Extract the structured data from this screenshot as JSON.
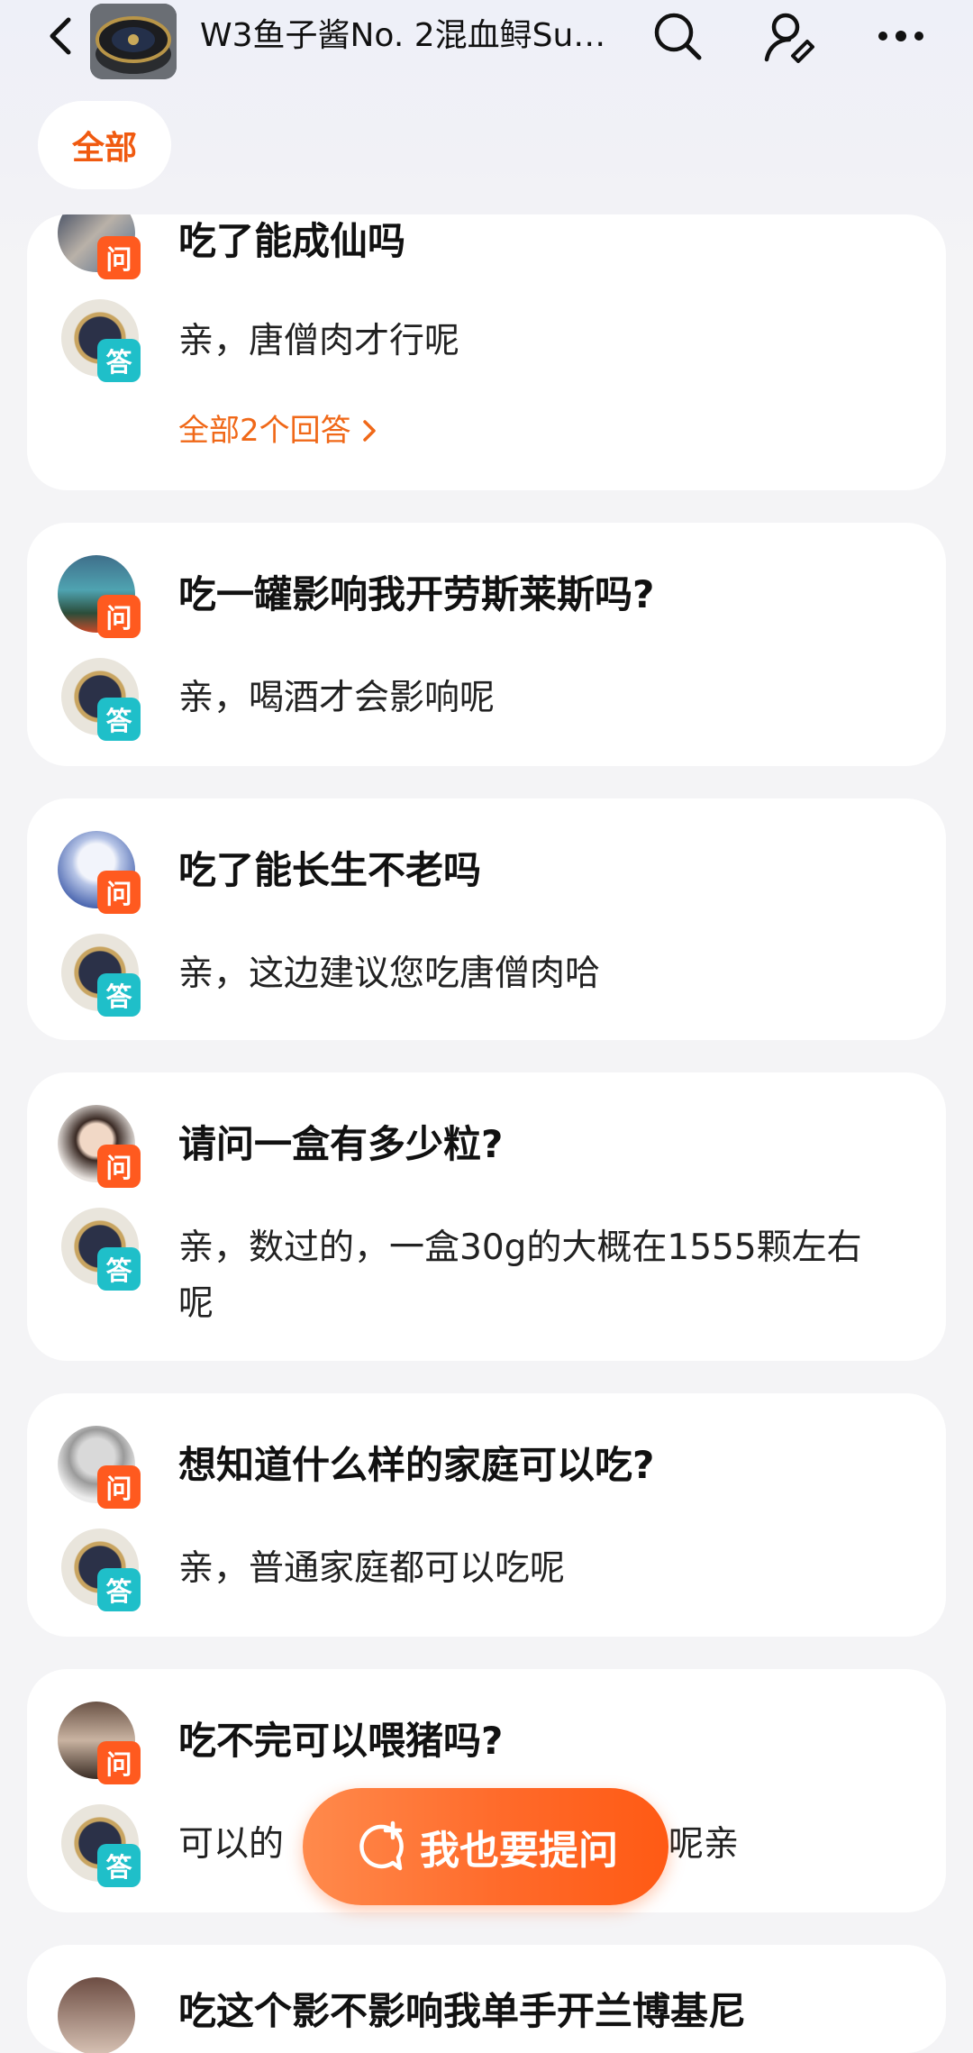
{
  "header": {
    "title": "W3鱼子酱No. 2混血鲟Sup..."
  },
  "tab": {
    "label": "全部"
  },
  "cards": [
    {
      "question": "吃了能成仙吗",
      "answer": "亲，唐僧肉才行呢",
      "more": "全部2个回答"
    },
    {
      "question": "吃一罐影响我开劳斯莱斯吗?",
      "answer": "亲，喝酒才会影响呢"
    },
    {
      "question": "吃了能长生不老吗",
      "answer": "亲，这边建议您吃唐僧肉哈"
    },
    {
      "question": "请问一盒有多少粒?",
      "answer_line1": "亲，数过的，一盒30g的大概在1555颗左右",
      "answer_line2": "呢"
    },
    {
      "question": "想知道什么样的家庭可以吃?",
      "answer": "亲，普通家庭都可以吃呢"
    },
    {
      "question": "吃不完可以喂猪吗?",
      "answer_left": "可以的",
      "answer_right": "呢亲"
    },
    {
      "question": "吃这个影不影响我单手开兰博基尼"
    }
  ],
  "badges": {
    "q": "问",
    "a": "答"
  },
  "ask_button": {
    "label": "我也要提问"
  },
  "colors": {
    "accent": "#f05a10",
    "q_badge": "#ff5a1f",
    "a_badge": "#1fbfc9"
  },
  "icons": {
    "back": "chevron-left-icon",
    "search": "search-icon",
    "ask": "person-question-icon",
    "more": "more-dots-icon",
    "chevron": "chevron-right-icon",
    "chat": "chat-bubble-plus-icon"
  }
}
